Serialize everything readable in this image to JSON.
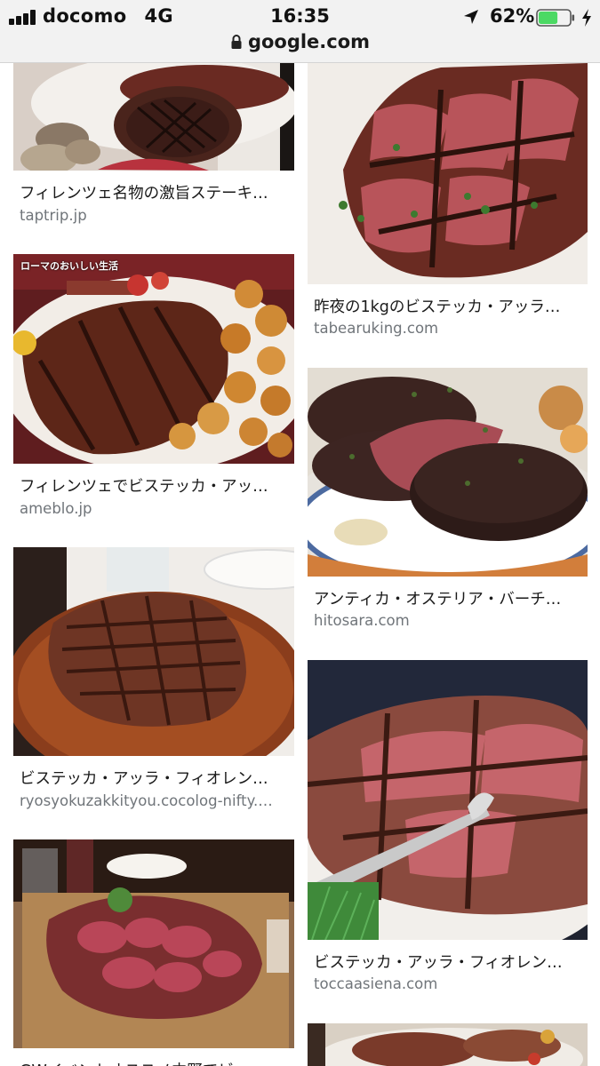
{
  "status_bar": {
    "carrier": "docomo",
    "network": "4G",
    "time": "16:35",
    "battery_percent": "62%",
    "battery_level": 0.62,
    "icons": [
      "signal-bars-icon",
      "location-arrow-icon",
      "battery-icon",
      "charging-bolt-icon"
    ]
  },
  "url_bar": {
    "url": "google.com",
    "icon": "lock-icon"
  },
  "results": [
    {
      "title": "フィレンツェ名物の激旨ステーキ…",
      "site": "taptrip.jp"
    },
    {
      "title": "昨夜の1kgのビステッカ・アッラ…",
      "site": "tabearuking.com"
    },
    {
      "title": "フィレンツェでビステッカ・アッ…",
      "site": "ameblo.jp",
      "image_caption": "ローマのおいしい生活"
    },
    {
      "title": "アンティカ・オステリア・バーチ…",
      "site": "hitosara.com"
    },
    {
      "title": "ビステッカ・アッラ・フィオレン…",
      "site": "ryosyokuzakkityou.cocolog-nifty.…"
    },
    {
      "title": "ビステッカ・アッラ・フィオレン…",
      "site": "toccaasiena.com"
    },
    {
      "title": "GWイベントオススメ中野でビ…",
      "site": ""
    },
    {
      "title": "",
      "site": ""
    }
  ],
  "colors": {
    "bar_bg": "#f2f2f2",
    "title_text": "#1a1a1a",
    "site_text": "#70757a",
    "battery_green": "#4cd964"
  }
}
